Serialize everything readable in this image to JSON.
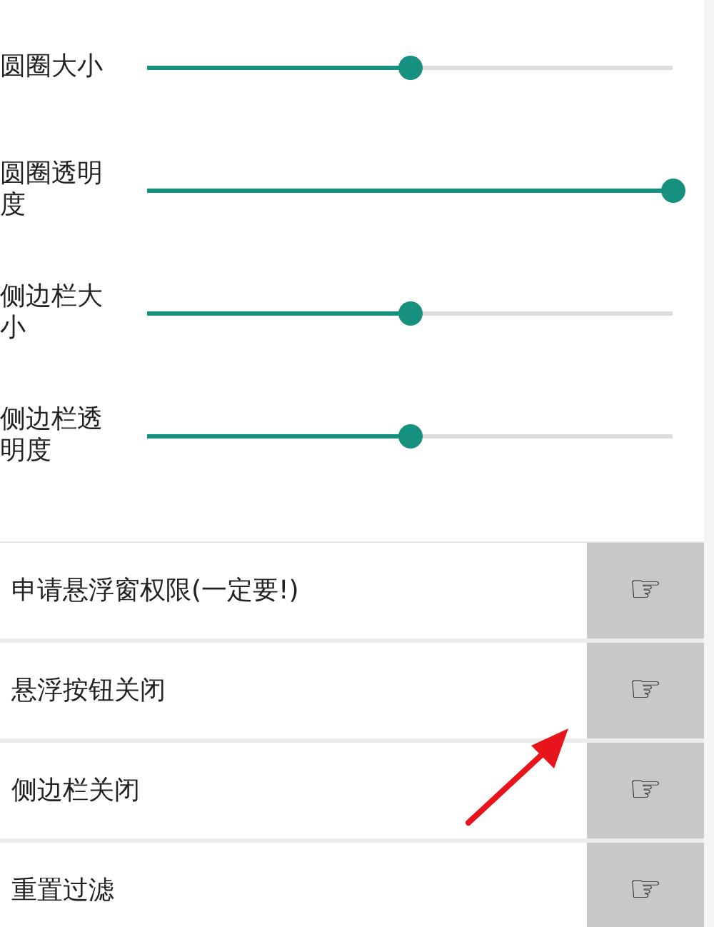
{
  "sliders": [
    {
      "label": "圆圈大小",
      "level": 0.5
    },
    {
      "label": "圆圈透明度",
      "level": 1.0
    },
    {
      "label": "侧边栏大小",
      "level": 0.5
    },
    {
      "label": "侧边栏透明度",
      "level": 0.5
    }
  ],
  "actions": [
    {
      "label": "申请悬浮窗权限(一定要!)",
      "button": "☞"
    },
    {
      "label": "悬浮按钮关闭",
      "button": "☞"
    },
    {
      "label": "侧边栏关闭",
      "button": "☞"
    },
    {
      "label": "重置过滤",
      "button": "☞"
    }
  ]
}
